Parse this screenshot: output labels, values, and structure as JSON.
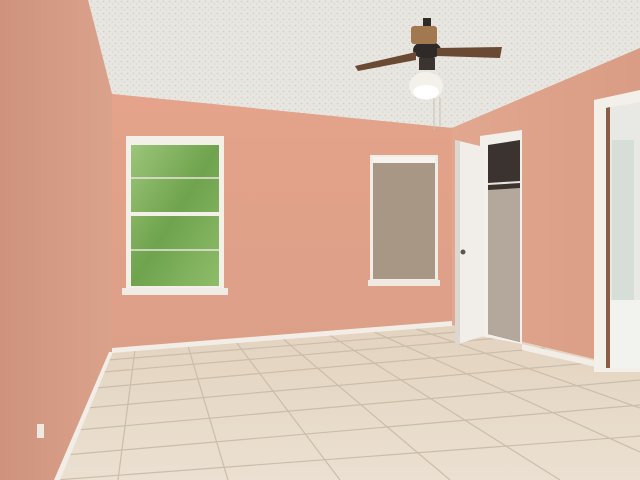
{
  "scene": {
    "subject": "empty-bedroom",
    "colors": {
      "wall": "#dca28a",
      "wall_shadow": "#c98d78",
      "ceiling": "#e9e6e0",
      "floor_tile": "#e8dccb",
      "grout": "#cfc2ae",
      "baseboard": "#f2ede6",
      "door": "#f1eee9",
      "window_green": "#7fb05c",
      "fan_blade": "#6b4a33"
    }
  }
}
